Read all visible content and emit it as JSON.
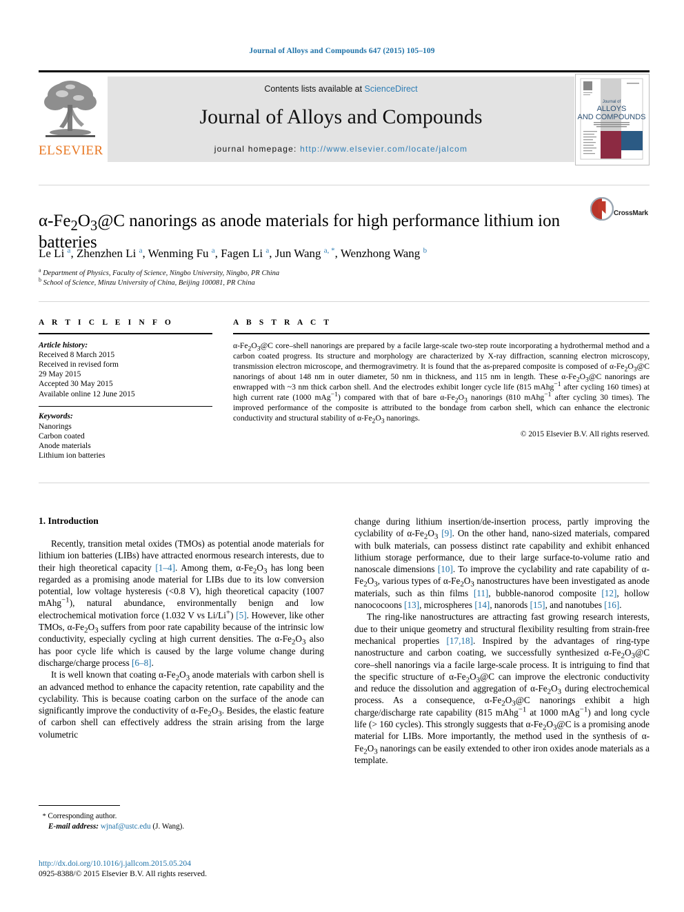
{
  "running_head": "Journal of Alloys and Compounds 647 (2015) 105–109",
  "masthead": {
    "contents_prefix": "Contents lists available at ",
    "contents_link": "ScienceDirect",
    "journal_title": "Journal of Alloys and Compounds",
    "homepage_prefix": "journal homepage: ",
    "homepage_url": "http://www.elsevier.com/locate/jalcom",
    "publisher": "ELSEVIER",
    "cover_line1": "Journal of",
    "cover_line2": "ALLOYS",
    "cover_line3": "AND COMPOUNDS"
  },
  "article": {
    "title_html": "α-Fe<sub>2</sub>O<sub>3</sub>@C nanorings as anode materials for high performance lithium ion batteries",
    "crossmark_label": "CrossMark",
    "authors_html": "Le Li <sup>a</sup>, Zhenzhen Li <sup>a</sup>, Wenming Fu <sup>a</sup>, Fagen Li <sup>a</sup>, Jun Wang <sup>a, *</sup>, Wenzhong Wang <sup>b</sup>",
    "affiliations": [
      "Department of Physics, Faculty of Science, Ningbo University, Ningbo, PR China",
      "School of Science, Minzu University of China, Beijing 100081, PR China"
    ],
    "affiliation_markers": [
      "a",
      "b"
    ]
  },
  "article_info": {
    "heading": "A R T I C L E    I N F O",
    "history_label": "Article history:",
    "history": [
      "Received 8 March 2015",
      "Received in revised form",
      "29 May 2015",
      "Accepted 30 May 2015",
      "Available online 12 June 2015"
    ],
    "keywords_label": "Keywords:",
    "keywords": [
      "Nanorings",
      "Carbon coated",
      "Anode materials",
      "Lithium ion batteries"
    ]
  },
  "abstract": {
    "heading": "A B S T R A C T",
    "text_html": "α-Fe<sub>2</sub>O<sub>3</sub>@C core–shell nanorings are prepared by a facile large-scale two-step route incorporating a hydrothermal method and a carbon coated progress. Its structure and morphology are characterized by X-ray diffraction, scanning electron microscopy, transmission electron microscope, and thermogravimetry. It is found that the as-prepared composite is composed of α-Fe<sub>2</sub>O<sub>3</sub>@C nanorings of about 148 nm in outer diameter, 50 nm in thickness, and 115 nm in length. These α-Fe<sub>2</sub>O<sub>3</sub>@C nanorings are enwrapped with ~3 nm thick carbon shell. And the electrodes exhibit longer cycle life (815 mAhg<sup>−1</sup> after cycling 160 times) at high current rate (1000 mAg<sup>−1</sup>) compared with that of bare α-Fe<sub>2</sub>O<sub>3</sub> nanorings (810 mAhg<sup>−1</sup> after cycling 30 times). The improved performance of the composite is attributed to the bondage from carbon shell, which can enhance the electronic conductivity and structural stability of α-Fe<sub>2</sub>O<sub>3</sub> nanorings.",
    "copyright": "© 2015 Elsevier B.V. All rights reserved."
  },
  "body": {
    "section_heading": "1.  Introduction",
    "left_paragraphs_html": [
      "Recently, transition metal oxides (TMOs) as potential anode materials for lithium ion batteries (LIBs) have attracted enormous research interests, due to their high theoretical capacity <span class=\"ref\">[1–4]</span>. Among them, α-Fe<sub>2</sub>O<sub>3</sub> has long been regarded as a promising anode material for LIBs due to its low conversion potential, low voltage hysteresis (&lt;0.8 V), high theoretical capacity (1007 mAhg<sup>−1</sup>), natural abundance, environmentally benign and low electrochemical motivation force (1.032 V vs Li/Li<sup>+</sup>) <span class=\"ref\">[5]</span>. However, like other TMOs, α-Fe<sub>2</sub>O<sub>3</sub> suffers from poor rate capability because of the intrinsic low conductivity, especially cycling at high current densities. The α-Fe<sub>2</sub>O<sub>3</sub> also has poor cycle life which is caused by the large volume change during discharge/charge process <span class=\"ref\">[6–8]</span>.",
      "It is well known that coating α-Fe<sub>2</sub>O<sub>3</sub> anode materials with carbon shell is an advanced method to enhance the capacity retention, rate capability and the cyclability. This is because coating carbon on the surface of the anode can significantly improve the conductivity of α-Fe<sub>2</sub>O<sub>3</sub>. Besides, the elastic feature of carbon shell can effectively address the strain arising from the large volumetric"
    ],
    "right_paragraphs_html": [
      "change during lithium insertion/de-insertion process, partly improving the cyclability of α-Fe<sub>2</sub>O<sub>3</sub> <span class=\"ref\">[9]</span>. On the other hand, nano-sized materials, compared with bulk materials, can possess distinct rate capability and exhibit enhanced lithium storage performance, due to their large surface-to-volume ratio and nanoscale dimensions <span class=\"ref\">[10]</span>. To improve the cyclability and rate capability of α-Fe<sub>2</sub>O<sub>3</sub>, various types of α-Fe<sub>2</sub>O<sub>3</sub> nanostructures have been investigated as anode materials, such as thin films <span class=\"ref\">[11]</span>, bubble-nanorod composite <span class=\"ref\">[12]</span>, hollow nanococoons <span class=\"ref\">[13]</span>, microspheres <span class=\"ref\">[14]</span>, nanorods <span class=\"ref\">[15]</span>, and nanotubes <span class=\"ref\">[16]</span>.",
      "The ring-like nanostructures are attracting fast growing research interests, due to their unique geometry and structural flexibility resulting from strain-free mechanical properties <span class=\"ref\">[17,18]</span>. Inspired by the advantages of ring-type nanostructure and carbon coating, we successfully synthesized α-Fe<sub>2</sub>O<sub>3</sub>@C core–shell nanorings via a facile large-scale process. It is intriguing to find that the specific structure of α-Fe<sub>2</sub>O<sub>3</sub>@C can improve the electronic conductivity and reduce the dissolution and aggregation of α-Fe<sub>2</sub>O<sub>3</sub> during electrochemical process. As a consequence, α-Fe<sub>2</sub>O<sub>3</sub>@C nanorings exhibit a high charge/discharge rate capability (815 mAhg<sup>−1</sup> at 1000 mAg<sup>−1</sup>) and long cycle life (&gt; 160 cycles). This strongly suggests that α-Fe<sub>2</sub>O<sub>3</sub>@C is a promising anode material for LIBs. More importantly, the method used in the synthesis of α-Fe<sub>2</sub>O<sub>3</sub> nanorings can be easily extended to other iron oxides anode materials as a template."
    ]
  },
  "footnote": {
    "corresponding_author": "Corresponding author.",
    "email_label": "E-mail address:",
    "email": "wjnaf@ustc.edu",
    "email_owner": "(J. Wang)."
  },
  "publication": {
    "doi_url": "http://dx.doi.org/10.1016/j.jallcom.2015.05.204",
    "issn_line": "0925-8388/© 2015 Elsevier B.V. All rights reserved."
  },
  "colors": {
    "link_blue": "#1f72a8",
    "elsevier_orange": "#e87722",
    "band_grey": "#e3e3e3",
    "cover_maroon": "#8c2a42",
    "cover_navy": "#2b5a84"
  }
}
